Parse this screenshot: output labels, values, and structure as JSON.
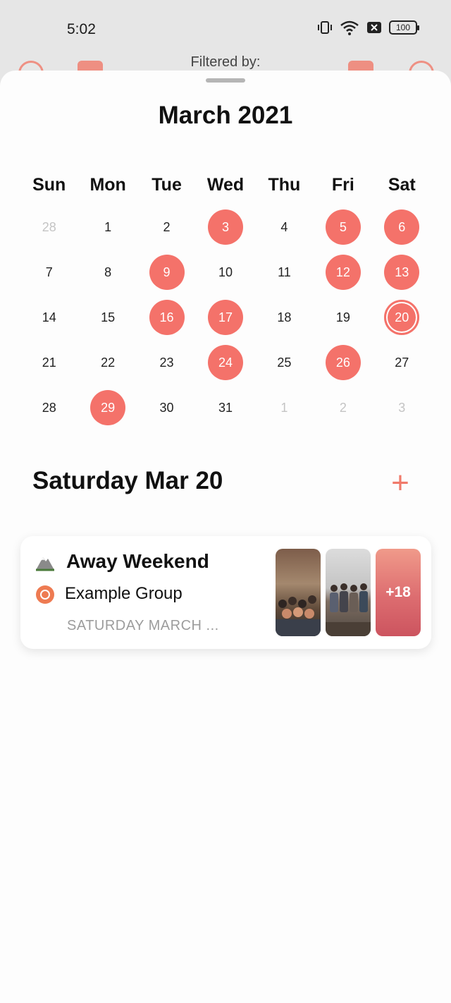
{
  "status_bar": {
    "time": "5:02",
    "battery": "100"
  },
  "background_toolbar": {
    "filtered_label": "Filtered by:"
  },
  "calendar": {
    "month_title": "March 2021",
    "weekdays": [
      "Sun",
      "Mon",
      "Tue",
      "Wed",
      "Thu",
      "Fri",
      "Sat"
    ],
    "days": [
      {
        "label": "28",
        "state": "muted"
      },
      {
        "label": "1",
        "state": "normal"
      },
      {
        "label": "2",
        "state": "normal"
      },
      {
        "label": "3",
        "state": "event"
      },
      {
        "label": "4",
        "state": "normal"
      },
      {
        "label": "5",
        "state": "event"
      },
      {
        "label": "6",
        "state": "event"
      },
      {
        "label": "7",
        "state": "normal"
      },
      {
        "label": "8",
        "state": "normal"
      },
      {
        "label": "9",
        "state": "event"
      },
      {
        "label": "10",
        "state": "normal"
      },
      {
        "label": "11",
        "state": "normal"
      },
      {
        "label": "12",
        "state": "event"
      },
      {
        "label": "13",
        "state": "event"
      },
      {
        "label": "14",
        "state": "normal"
      },
      {
        "label": "15",
        "state": "normal"
      },
      {
        "label": "16",
        "state": "event"
      },
      {
        "label": "17",
        "state": "event"
      },
      {
        "label": "18",
        "state": "normal"
      },
      {
        "label": "19",
        "state": "normal"
      },
      {
        "label": "20",
        "state": "selected"
      },
      {
        "label": "21",
        "state": "normal"
      },
      {
        "label": "22",
        "state": "normal"
      },
      {
        "label": "23",
        "state": "normal"
      },
      {
        "label": "24",
        "state": "event"
      },
      {
        "label": "25",
        "state": "normal"
      },
      {
        "label": "26",
        "state": "event"
      },
      {
        "label": "27",
        "state": "normal"
      },
      {
        "label": "28",
        "state": "normal"
      },
      {
        "label": "29",
        "state": "event"
      },
      {
        "label": "30",
        "state": "normal"
      },
      {
        "label": "31",
        "state": "normal"
      },
      {
        "label": "1",
        "state": "muted"
      },
      {
        "label": "2",
        "state": "muted"
      },
      {
        "label": "3",
        "state": "muted"
      }
    ]
  },
  "selected_day": {
    "header": "Saturday Mar 20",
    "add_label": "+"
  },
  "event": {
    "emoji_icon": "mountain-icon",
    "title": "Away Weekend",
    "group": "Example Group",
    "date": "SATURDAY MARCH ...",
    "more_photos": "+18"
  },
  "colors": {
    "accent": "#f4726a",
    "muted": "#c4c4c4"
  }
}
